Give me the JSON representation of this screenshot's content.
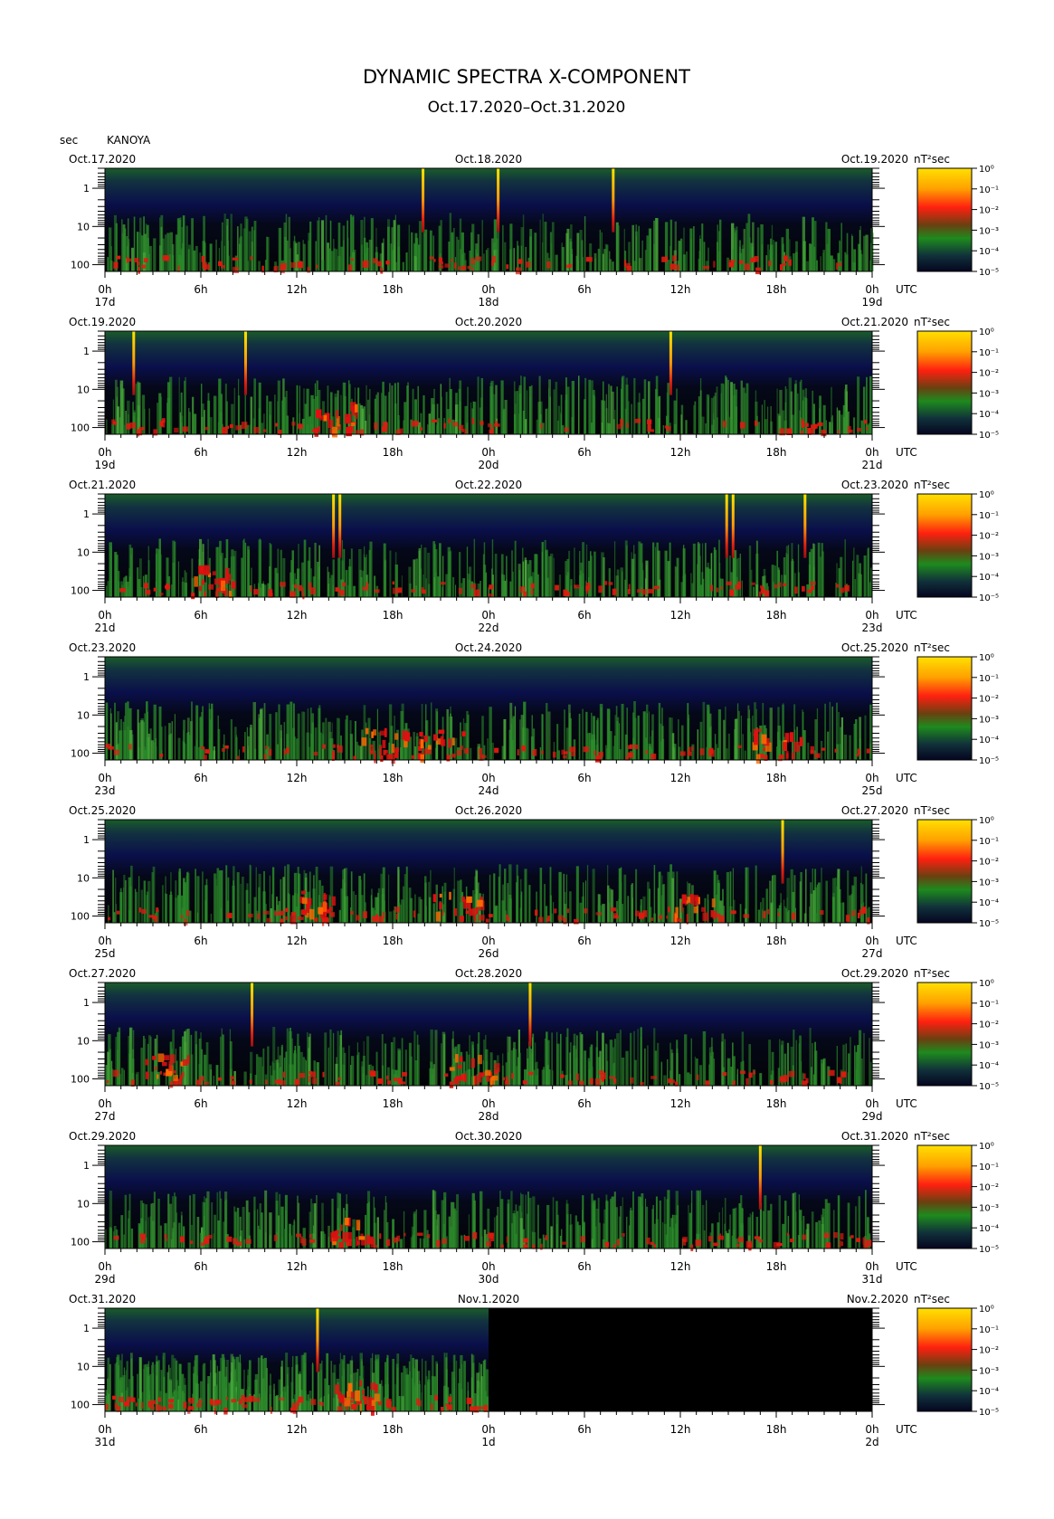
{
  "title": "DYNAMIC SPECTRA X-COMPONENT",
  "subtitle": "Oct.17.2020–Oct.31.2020",
  "y_unit": "sec",
  "station": "KANOYA",
  "colorbar_unit": "nT²sec",
  "utc_label": "UTC",
  "y_tick_labels": [
    "1",
    "10",
    "100"
  ],
  "colorbar_ticks": [
    "10⁰",
    "10⁻¹",
    "10⁻²",
    "10⁻³",
    "10⁻⁴",
    "10⁻⁵"
  ],
  "colors": {
    "background": "#000000",
    "low": "#0a0a40",
    "mid": "#1e7a1e",
    "high": "#e01010",
    "peak": "#ffd800"
  },
  "chart_data": {
    "type": "heatmap",
    "x_ticks": [
      "0h",
      "6h",
      "12h",
      "18h",
      "0h",
      "6h",
      "12h",
      "18h",
      "0h"
    ],
    "y_axis": {
      "label": "sec",
      "scale": "log",
      "ticks": [
        1,
        10,
        100
      ]
    },
    "colorbar": {
      "scale": "log",
      "range": [
        1e-05,
        1
      ],
      "unit": "nT²sec"
    },
    "panels": [
      {
        "date_left": "Oct.17.2020",
        "date_mid": "Oct.18.2020",
        "date_right": "Oct.19.2020",
        "day_labels": [
          "17d",
          "18d",
          "19d"
        ],
        "spikes_hours": [
          19.9,
          24.6,
          31.8
        ],
        "event_hours": [],
        "no_data_after": null
      },
      {
        "date_left": "Oct.19.2020",
        "date_mid": "Oct.20.2020",
        "date_right": "Oct.21.2020",
        "day_labels": [
          "19d",
          "20d",
          "21d"
        ],
        "spikes_hours": [
          1.8,
          8.8,
          35.4
        ],
        "event_hours": [
          14.5
        ],
        "no_data_after": null
      },
      {
        "date_left": "Oct.21.2020",
        "date_mid": "Oct.22.2020",
        "date_right": "Oct.23.2020",
        "day_labels": [
          "21d",
          "22d",
          "23d"
        ],
        "spikes_hours": [
          14.3,
          14.7,
          38.9,
          39.3,
          43.8
        ],
        "event_hours": [
          6.5
        ],
        "no_data_after": null
      },
      {
        "date_left": "Oct.23.2020",
        "date_mid": "Oct.24.2020",
        "date_right": "Oct.25.2020",
        "day_labels": [
          "23d",
          "24d",
          "25d"
        ],
        "spikes_hours": [],
        "event_hours": [
          17.5,
          21.0,
          42.0
        ],
        "no_data_after": null
      },
      {
        "date_left": "Oct.25.2020",
        "date_mid": "Oct.26.2020",
        "date_right": "Oct.27.2020",
        "day_labels": [
          "25d",
          "26d",
          "27d"
        ],
        "spikes_hours": [
          42.4
        ],
        "event_hours": [
          12.8,
          22.0,
          37.0
        ],
        "no_data_after": null
      },
      {
        "date_left": "Oct.27.2020",
        "date_mid": "Oct.28.2020",
        "date_right": "Oct.29.2020",
        "day_labels": [
          "27d",
          "28d",
          "29d"
        ],
        "spikes_hours": [
          9.2,
          26.6
        ],
        "event_hours": [
          4.0,
          23.0
        ],
        "no_data_after": null
      },
      {
        "date_left": "Oct.29.2020",
        "date_mid": "Oct.30.2020",
        "date_right": "Oct.31.2020",
        "day_labels": [
          "29d",
          "30d",
          "31d"
        ],
        "spikes_hours": [
          41.0
        ],
        "event_hours": [
          15.5
        ],
        "no_data_after": null
      },
      {
        "date_left": "Oct.31.2020",
        "date_mid": "Nov.1.2020",
        "date_right": "Nov.2.2020",
        "day_labels": [
          "31d",
          "1d",
          "2d"
        ],
        "spikes_hours": [
          13.3
        ],
        "event_hours": [
          15.5
        ],
        "no_data_after": 24
      }
    ]
  }
}
